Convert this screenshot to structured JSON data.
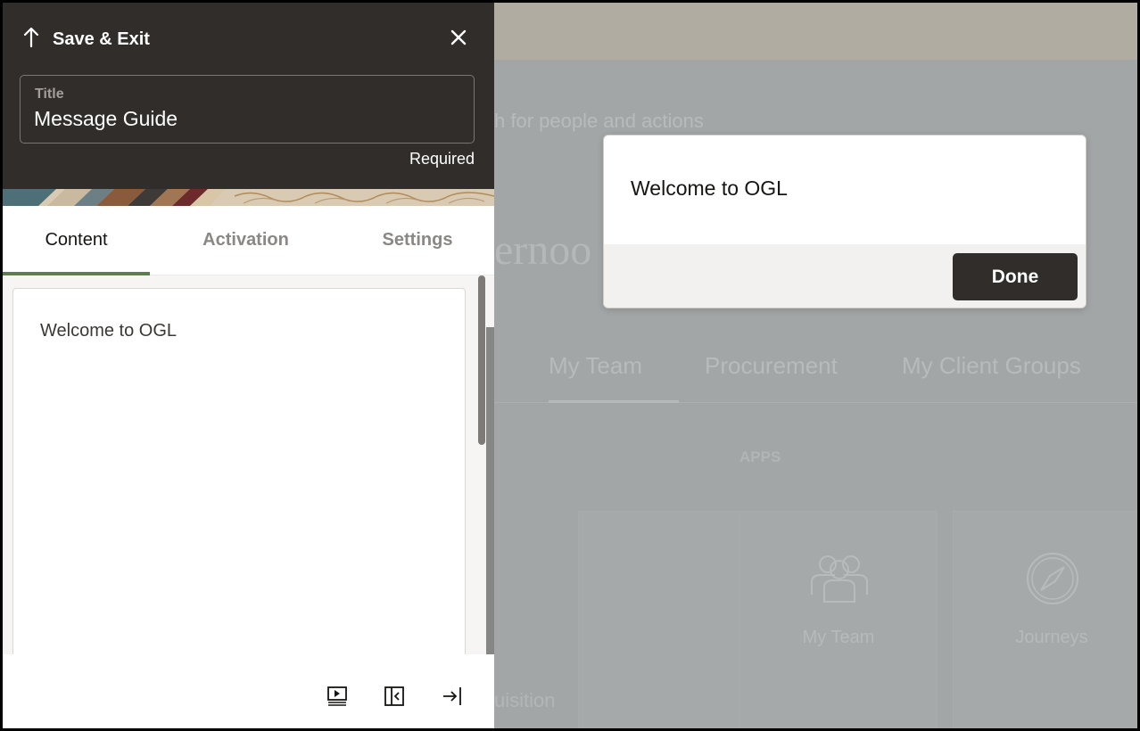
{
  "panel": {
    "header": {
      "title": "Save & Exit",
      "title_field": {
        "label": "Title",
        "value": "Message Guide"
      },
      "required_text": "Required"
    },
    "tabs": [
      {
        "label": "Content",
        "active": true
      },
      {
        "label": "Activation",
        "active": false
      },
      {
        "label": "Settings",
        "active": false
      }
    ],
    "editor": {
      "text": "Welcome to OGL"
    },
    "footer_icons": [
      "preview-icon",
      "collapse-panel-icon",
      "dock-right-icon"
    ]
  },
  "popup": {
    "message": "Welcome to OGL",
    "done_label": "Done"
  },
  "background": {
    "search_fragment": "h for people and actions",
    "greeting_fragment": "ernoo",
    "tabs": [
      "My Team",
      "Procurement",
      "My Client Groups"
    ],
    "apps_label": "APPS",
    "cards": [
      "My Team",
      "Journeys"
    ],
    "bottom_fragment": "uisition"
  },
  "colors": {
    "header_bg": "#312d2a",
    "tab_accent": "#5f7d4f",
    "done_button": "#312d2a",
    "overlay": "#a3a6a6"
  }
}
